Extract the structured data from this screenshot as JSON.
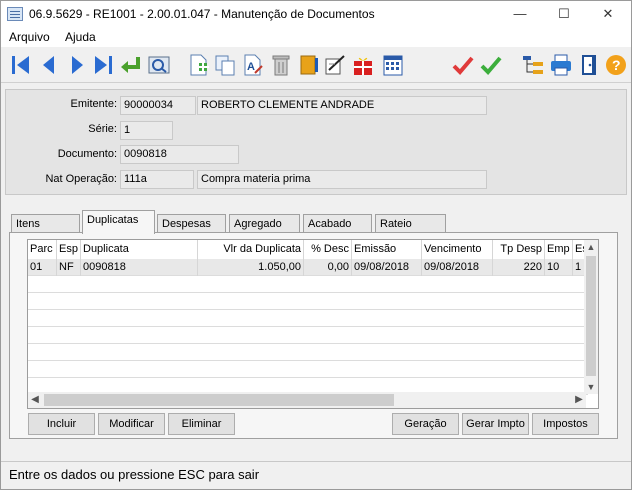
{
  "window": {
    "title": "06.9.5629 - RE1001 - 2.00.01.047 - Manutenção de Documentos",
    "controls": {
      "minimize": "—",
      "maximize": "☐",
      "close": "✕"
    }
  },
  "menu": {
    "file": "Arquivo",
    "help": "Ajuda"
  },
  "toolbar": {
    "icons": [
      "first-record-icon",
      "previous-record-icon",
      "next-record-icon",
      "last-record-icon",
      "goto-icon",
      "search-icon",
      "new-icon",
      "copy-icon",
      "edit-icon",
      "delete-icon",
      "documents-icon",
      "sign-icon",
      "gift-icon",
      "calendar-icon",
      "confirm-icon",
      "ok-icon",
      "tree-icon",
      "print-icon",
      "exit-icon",
      "help-icon"
    ]
  },
  "header": {
    "emitente_label": "Emitente:",
    "emitente_code": "90000034",
    "emitente_name": "ROBERTO CLEMENTE ANDRADE",
    "serie_label": "Série:",
    "serie_value": "1",
    "documento_label": "Documento:",
    "documento_value": "0090818",
    "natop_label": "Nat Operação:",
    "natop_code": "111a",
    "natop_desc": "Compra materia prima"
  },
  "tabs": [
    "Itens",
    "Duplicatas",
    "Despesas",
    "Agregado",
    "Acabado",
    "Rateio"
  ],
  "active_tab": "Duplicatas",
  "grid": {
    "columns": [
      "Parc",
      "Esp",
      "Duplicata",
      "Vlr da Duplicata",
      "% Desc",
      "Emissão",
      "Vencimento",
      "Tp Desp",
      "Emp",
      "Es"
    ],
    "rows": [
      [
        "01",
        "NF",
        "0090818",
        "1.050,00",
        "0,00",
        "09/08/2018",
        "09/08/2018",
        "220",
        "10",
        "1"
      ]
    ]
  },
  "buttons": {
    "incluir": "Incluir",
    "modificar": "Modificar",
    "eliminar": "Eliminar",
    "geracao": "Geração",
    "gerar_impto": "Gerar Impto",
    "impostos": "Impostos"
  },
  "status": "Entre os dados ou pressione ESC para sair"
}
